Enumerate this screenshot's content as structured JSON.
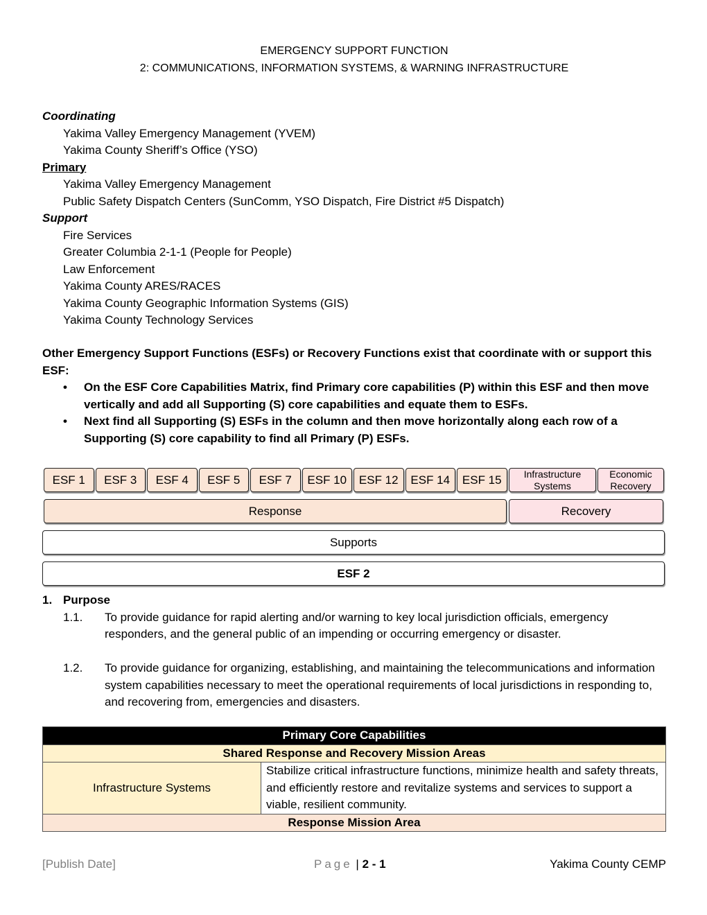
{
  "title": {
    "line1": "EMERGENCY SUPPORT FUNCTION",
    "line2": "2: COMMUNICATIONS, INFORMATION SYSTEMS, & WARNING INFRASTRUCTURE"
  },
  "agencies": {
    "coordinating": {
      "label": "Coordinating",
      "items": [
        "Yakima Valley Emergency Management (YVEM)",
        "Yakima County Sheriff’s Office (YSO)"
      ]
    },
    "primary": {
      "label": "Primary",
      "items": [
        "Yakima Valley Emergency Management",
        "Public Safety Dispatch Centers (SunComm, YSO Dispatch, Fire District #5 Dispatch)"
      ]
    },
    "support": {
      "label": "Support",
      "items": [
        "Fire Services",
        "Greater Columbia 2-1-1 (People for People)",
        "Law Enforcement",
        "Yakima County ARES/RACES",
        "Yakima County Geographic Information Systems (GIS)",
        "Yakima County Technology Services"
      ]
    }
  },
  "other_esfs": {
    "intro": "Other Emergency Support Functions (ESFs) or Recovery Functions exist that coordinate with or support this ESF:",
    "bullets": [
      "On the ESF Core Capabilities Matrix, find Primary core capabilities (P) within this ESF and then move vertically and add all Supporting (S) core capabilities and equate them to ESFs.",
      "Next find all Supporting (S) ESFs in the column and then move horizontally along each row of a Supporting (S) core capability to find all Primary (P) ESFs."
    ]
  },
  "matrix": {
    "response_esfs": [
      "ESF 1",
      "ESF 3",
      "ESF 4",
      "ESF 5",
      "ESF 7",
      "ESF 10",
      "ESF 12",
      "ESF 14",
      "ESF 15"
    ],
    "recovery_functions": [
      "Infrastructure Systems",
      "Economic Recovery"
    ],
    "response_label": "Response",
    "recovery_label": "Recovery",
    "supports_label": "Supports",
    "esf_label": "ESF 2",
    "colors": {
      "response": "#fbe5d6",
      "recovery": "#fde2e6"
    }
  },
  "purpose": {
    "heading_num": "1.",
    "heading": "Purpose",
    "items": [
      {
        "num": "1.1.",
        "text": "To provide guidance for rapid alerting and/or warning to key local jurisdiction officials, emergency responders, and the general public of an impending or occurring emergency or disaster."
      },
      {
        "num": "1.2.",
        "text": "To provide guidance for organizing, establishing, and maintaining the telecommunications and information system capabilities necessary to meet the operational requirements of local jurisdictions in responding to, and recovering from, emergencies and disasters."
      }
    ]
  },
  "capabilities_table": {
    "header": "Primary Core Capabilities",
    "shared_header": "Shared Response and Recovery Mission Areas",
    "rows": [
      {
        "name": "Infrastructure Systems",
        "description": "Stabilize critical infrastructure functions, minimize health and safety threats, and efficiently restore and revitalize systems and services to support a viable, resilient community."
      }
    ],
    "response_header": "Response Mission Area"
  },
  "footer": {
    "publish_date": "[Publish Date]",
    "page_word": "Page",
    "page_number": "2 - 1",
    "document": "Yakima County CEMP"
  }
}
